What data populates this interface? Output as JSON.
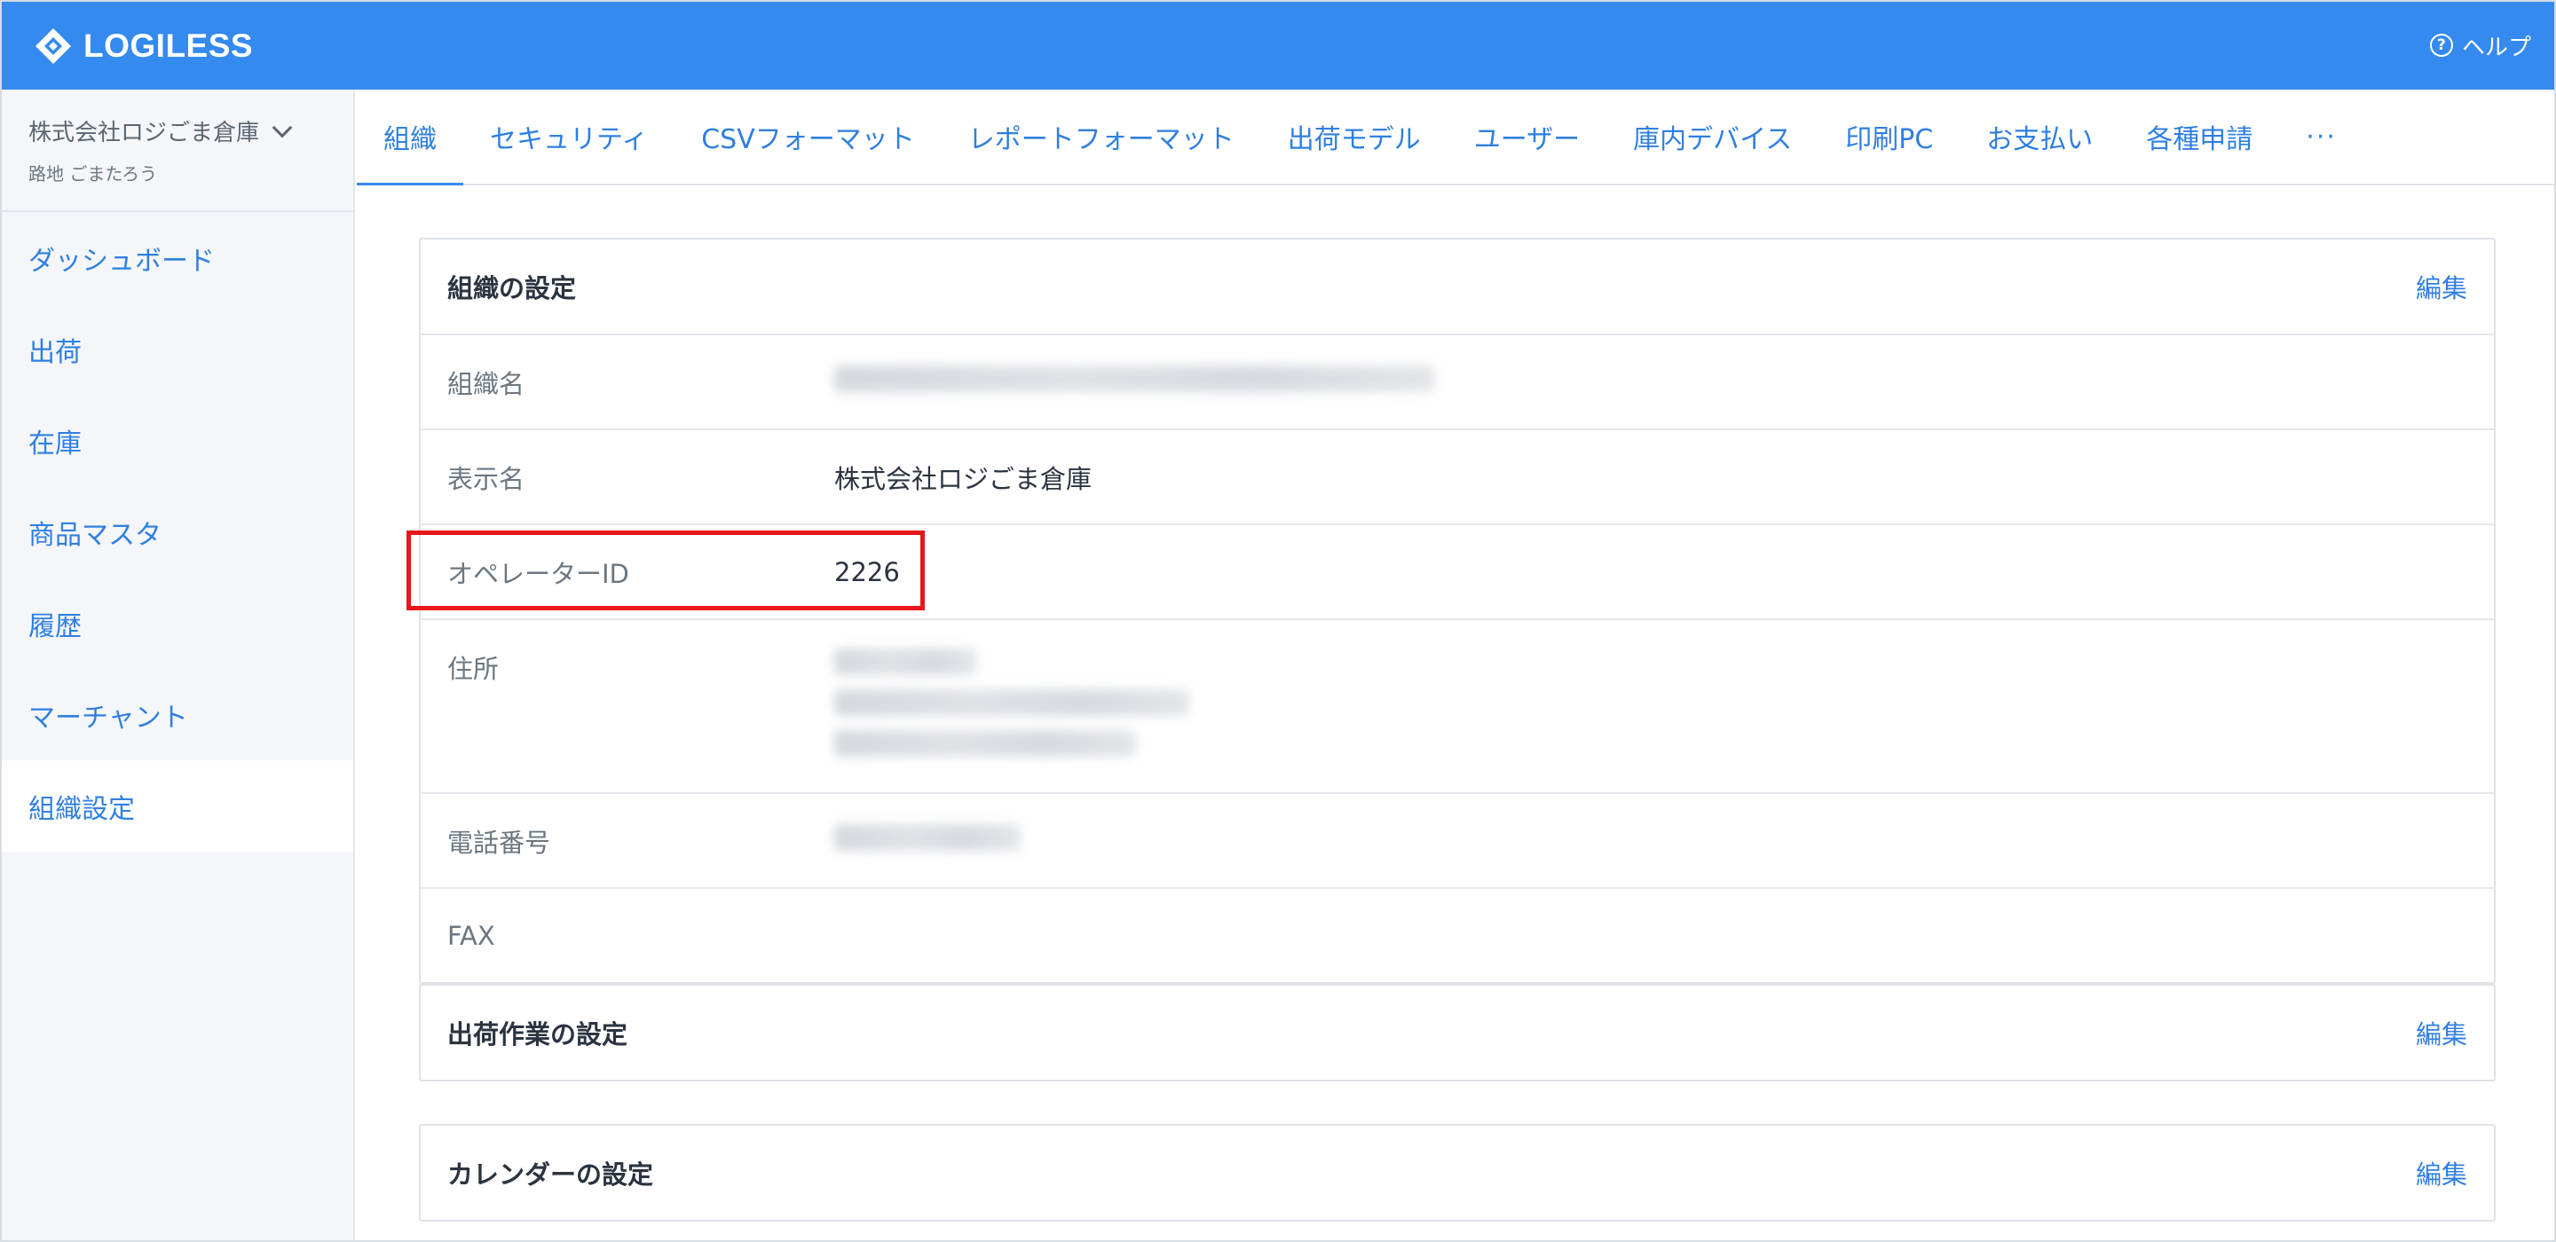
{
  "header": {
    "logo_text": "LOGILESS",
    "help_label": "ヘルプ",
    "help_icon": "?",
    "brand_color": "#348aee"
  },
  "sidebar": {
    "org_name": "株式会社ロジごま倉庫",
    "user_name": "路地 ごまたろう",
    "items": [
      {
        "label": "ダッシュボード"
      },
      {
        "label": "出荷"
      },
      {
        "label": "在庫"
      },
      {
        "label": "商品マスタ"
      },
      {
        "label": "履歴"
      },
      {
        "label": "マーチャント"
      },
      {
        "label": "組織設定"
      }
    ],
    "active_index": 6
  },
  "tabs": [
    {
      "label": "組織"
    },
    {
      "label": "セキュリティ"
    },
    {
      "label": "CSVフォーマット"
    },
    {
      "label": "レポートフォーマット"
    },
    {
      "label": "出荷モデル"
    },
    {
      "label": "ユーザー"
    },
    {
      "label": "庫内デバイス"
    },
    {
      "label": "印刷PC"
    },
    {
      "label": "お支払い"
    },
    {
      "label": "各種申請"
    },
    {
      "label": "···"
    }
  ],
  "org_settings": {
    "title": "組織の設定",
    "edit_label": "編集",
    "rows": [
      {
        "label": "組織名",
        "value": ""
      },
      {
        "label": "表示名",
        "value": "株式会社ロジごま倉庫"
      },
      {
        "label": "オペレーターID",
        "value": "2226"
      },
      {
        "label": "住所",
        "value": ""
      },
      {
        "label": "電話番号",
        "value": ""
      },
      {
        "label": "FAX",
        "value": ""
      }
    ],
    "highlight_color": "#e8161a"
  },
  "shipping_settings": {
    "title": "出荷作業の設定",
    "edit_label": "編集"
  },
  "calendar_settings": {
    "title": "カレンダーの設定",
    "edit_label": "編集"
  }
}
